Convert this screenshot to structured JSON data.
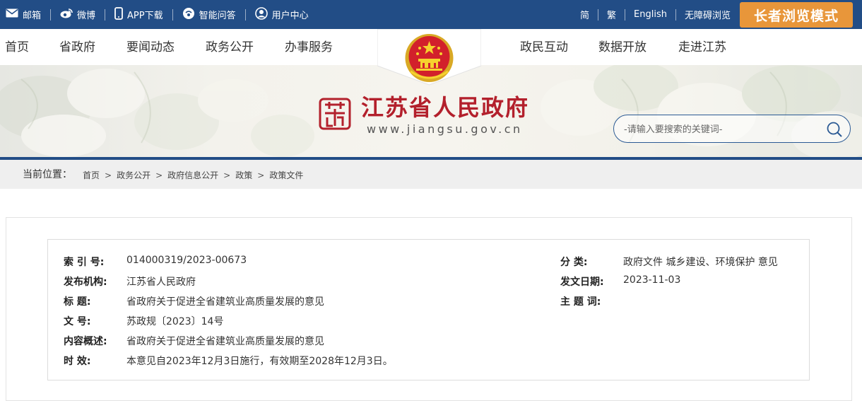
{
  "topbar": {
    "left": [
      {
        "label": "邮箱",
        "icon": "mail-icon"
      },
      {
        "label": "微博",
        "icon": "weibo-icon"
      },
      {
        "label": "APP下载",
        "icon": "phone-icon"
      },
      {
        "label": "智能问答",
        "icon": "chat-icon"
      },
      {
        "label": "用户中心",
        "icon": "user-icon"
      }
    ],
    "right": [
      "简",
      "繁",
      "English",
      "无障碍浏览"
    ],
    "elder_mode": "长者浏览模式"
  },
  "nav": {
    "left": [
      "首页",
      "省政府",
      "要闻动态",
      "政务公开",
      "办事服务"
    ],
    "right": [
      "政民互动",
      "数据开放",
      "走进江苏"
    ]
  },
  "header": {
    "site_title": "江苏省人民政府",
    "site_url": "www.jiangsu.gov.cn",
    "search_placeholder": "-请输入要搜索的关键词-"
  },
  "breadcrumb": {
    "label": "当前位置：",
    "items": [
      "首页",
      "政务公开",
      "政府信息公开",
      "政策",
      "政策文件"
    ]
  },
  "doc_info": {
    "index_no": {
      "label": "索 引 号:",
      "value": "014000319/2023-00673"
    },
    "issuer": {
      "label": "发布机构:",
      "value": "江苏省人民政府"
    },
    "title": {
      "label": "标 题:",
      "value": "省政府关于促进全省建筑业高质量发展的意见"
    },
    "doc_no": {
      "label": "文 号:",
      "value": "苏政规〔2023〕14号"
    },
    "summary": {
      "label": "内容概述:",
      "value": "省政府关于促进全省建筑业高质量发展的意见"
    },
    "validity": {
      "label": "时 效:",
      "value": "本意见自2023年12月3日施行，有效期至2028年12月3日。"
    },
    "category": {
      "label": "分 类:",
      "value": "政府文件 城乡建设、环境保护 意见"
    },
    "issue_date": {
      "label": "发文日期:",
      "value": "2023-11-03"
    },
    "keywords": {
      "label": "主 题 词:",
      "value": ""
    }
  },
  "colors": {
    "topbar": "#224d86",
    "elder_button": "#e8963a",
    "title_red": "#b3202c"
  }
}
